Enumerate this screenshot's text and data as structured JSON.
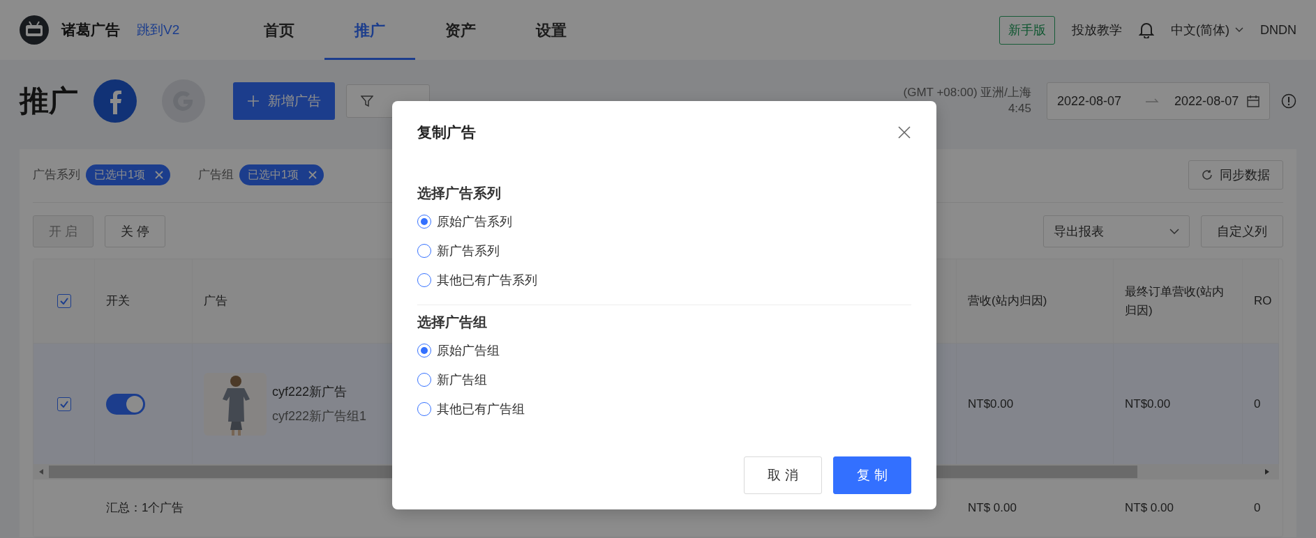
{
  "header": {
    "brand": "诸葛广告",
    "switch_link": "跳到V2",
    "nav": [
      {
        "label": "首页",
        "selected": false
      },
      {
        "label": "推广",
        "selected": true
      },
      {
        "label": "资产",
        "selected": false
      },
      {
        "label": "设置",
        "selected": false
      }
    ],
    "beginner_button": "新手版",
    "tutorial_link": "投放教学",
    "language": "中文(简体)",
    "user": "DNDN"
  },
  "page": {
    "title": "推广",
    "platforms": [
      {
        "kind": "facebook",
        "selected": true
      },
      {
        "kind": "google",
        "selected": false
      }
    ],
    "new_button": "新增广告",
    "timezone": "(GMT +08:00) 亚洲/上海",
    "time": "4:45",
    "date_start": "2022-08-07",
    "date_end": "2022-08-07"
  },
  "filters": [
    {
      "label": "广告系列",
      "tag": "已选中1项"
    },
    {
      "label": "广告组",
      "tag": "已选中1项"
    }
  ],
  "sync_button": "同步数据",
  "actions": [
    {
      "label": "开 启",
      "disabled": true
    },
    {
      "label": "关 停",
      "disabled": false
    }
  ],
  "export_select": "导出报表",
  "columns_button": "自定义列",
  "table": {
    "all_checked": true,
    "columns": [
      {
        "label": "开关"
      },
      {
        "label": "广告"
      },
      {
        "label": "营收(站内归因)"
      },
      {
        "label": "最终订单营收(站内归因)"
      },
      {
        "label": "RO"
      }
    ],
    "rows": [
      {
        "checked": true,
        "on": true,
        "ad_name": "cyf222新广告",
        "ad_group": "cyf222新广告组1",
        "revenue": "NT$0.00",
        "final_revenue": "NT$0.00",
        "col_ro": "0"
      }
    ],
    "summary": {
      "label": "汇总：1个广告",
      "revenue": "NT$ 0.00",
      "final_revenue": "NT$ 0.00",
      "col_ro": "0"
    }
  },
  "modal": {
    "title": "复制广告",
    "sections": [
      {
        "heading": "选择广告系列",
        "options": [
          {
            "label": "原始广告系列",
            "selected": true
          },
          {
            "label": "新广告系列",
            "selected": false
          },
          {
            "label": "其他已有广告系列",
            "selected": false
          }
        ]
      },
      {
        "heading": "选择广告组",
        "options": [
          {
            "label": "原始广告组",
            "selected": true
          },
          {
            "label": "新广告组",
            "selected": false
          },
          {
            "label": "其他已有广告组",
            "selected": false
          }
        ]
      }
    ],
    "buttons": [
      {
        "label": "取 消",
        "kind": "secondary"
      },
      {
        "label": "复 制",
        "kind": "primary"
      }
    ]
  }
}
